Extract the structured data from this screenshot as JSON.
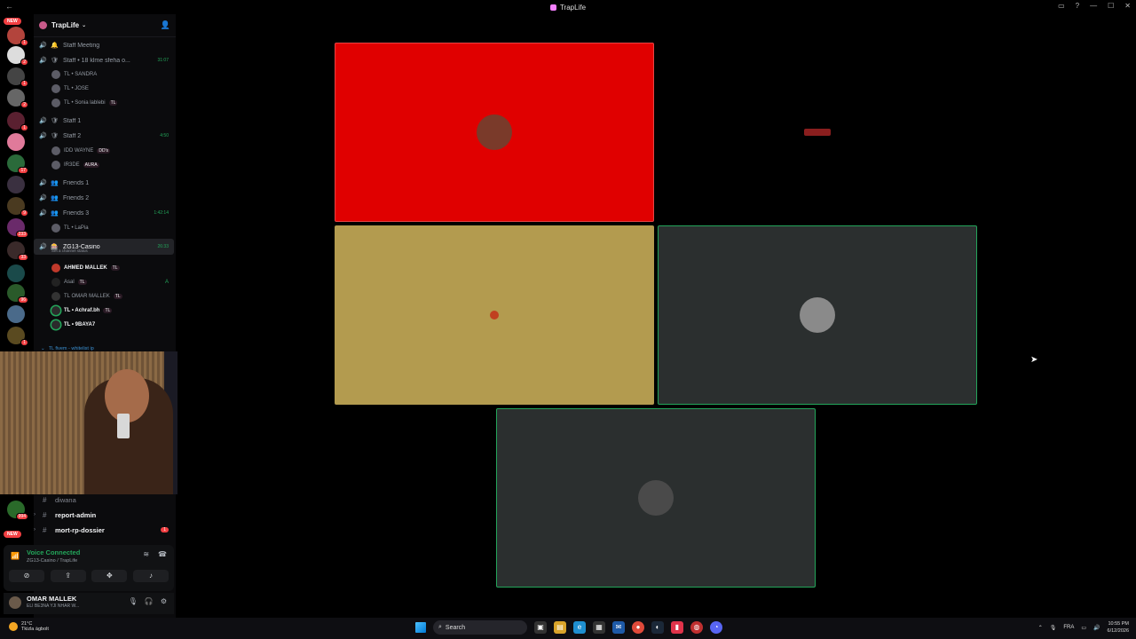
{
  "window": {
    "title": "TrapLife"
  },
  "server": {
    "name": "TrapLife"
  },
  "server_rail": {
    "new_label": "NEW",
    "badges": [
      "1",
      "2",
      "1",
      "2",
      "1",
      "17",
      "9",
      "233",
      "33",
      "96",
      "1",
      "994"
    ]
  },
  "channels": [
    {
      "name": "Staff Meeting",
      "emoji": "🔔",
      "active": false,
      "time": ""
    },
    {
      "name": "Staff • 18 klme sfeha o...",
      "emoji": "🛡",
      "active": true,
      "time": "31:07"
    },
    {
      "name": "Staff 1",
      "emoji": "🛡",
      "active": false,
      "time": ""
    },
    {
      "name": "Staff 2",
      "emoji": "🛡",
      "active": true,
      "time": "4:50"
    },
    {
      "name": "Friends 1",
      "emoji": "👥",
      "active": false,
      "time": ""
    },
    {
      "name": "Friends 2",
      "emoji": "👥",
      "active": false,
      "time": ""
    },
    {
      "name": "Friends 3",
      "emoji": "👥",
      "active": true,
      "time": "1:42:14"
    },
    {
      "name": "ZG13-Casino",
      "emoji": "🎰",
      "active": true,
      "time": "26:33",
      "status": "Set a channel status"
    }
  ],
  "members_staff": [
    {
      "name": "TL • SANDRA"
    },
    {
      "name": "TL • JOSE"
    },
    {
      "name": "TL • Sonia lablebi",
      "tag": "TL"
    }
  ],
  "members_staff2": [
    {
      "name": "IDD WAYNE",
      "tag": "DD's"
    },
    {
      "name": "IR3DE",
      "tag": "AURA"
    }
  ],
  "members_friends3": [
    {
      "name": "TL • LaPia"
    }
  ],
  "members_casino": [
    {
      "name": "AHMED MALLEK",
      "tag": "TL",
      "bright": true
    },
    {
      "name": "Asal",
      "tag": "TL",
      "bright": false
    },
    {
      "name": "TL OMAR MALLEK",
      "tag": "TL",
      "bright": false
    },
    {
      "name": "TL • Achraf.bh",
      "tag": "TL",
      "bright": true
    },
    {
      "name": "TL • 9BAYA7",
      "tag": "",
      "bright": true
    }
  ],
  "category": {
    "name": "TL fivem - whitelist ip"
  },
  "text_channels": [
    {
      "name": "diwana"
    },
    {
      "name": "report-admin"
    },
    {
      "name": "mort-rp-dossier",
      "badge": "1"
    }
  ],
  "voice": {
    "title": "Voice Connected",
    "subtitle": "ZG13-Casino / TrapLife"
  },
  "user": {
    "name": "OMAR MALLEK",
    "status": "ELI BE3NA YJI NHAR W..."
  },
  "taskbar": {
    "weather_temp": "21°C",
    "weather_desc": "Tkizla àgbolt",
    "search_placeholder": "Search",
    "lang": "FRA",
    "time": "10:55 PM",
    "date": "6/12/2026"
  },
  "colors": {
    "tile_red": "#e00000",
    "tile_mustard": "#b39b4f",
    "tile_slate": "#2b2f2f",
    "speaking_green": "#23a55a"
  }
}
